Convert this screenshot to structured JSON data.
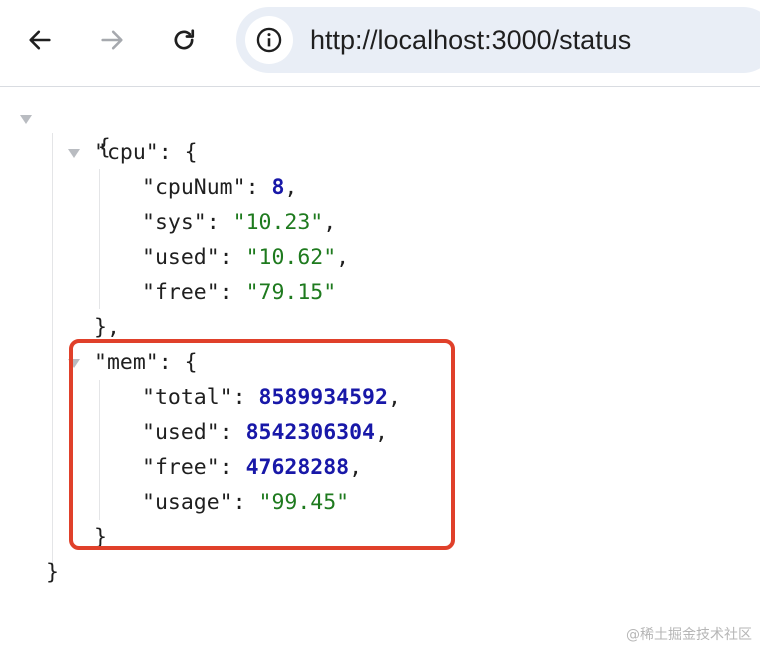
{
  "browser": {
    "url": "http://localhost:3000/status",
    "back_icon": "arrow-left-icon",
    "forward_icon": "arrow-right-icon",
    "reload_icon": "reload-icon",
    "site_info_icon": "info-icon"
  },
  "json": {
    "open_root": "{",
    "close_root": "}",
    "cpu": {
      "key": "\"cpu\"",
      "open": "{",
      "close": "},",
      "fields": [
        {
          "key": "\"cpuNum\"",
          "value": "8",
          "comma": ","
        },
        {
          "key": "\"sys\"",
          "value": "\"10.23\"",
          "comma": ","
        },
        {
          "key": "\"used\"",
          "value": "\"10.62\"",
          "comma": ","
        },
        {
          "key": "\"free\"",
          "value": "\"79.15\"",
          "comma": ""
        }
      ]
    },
    "mem": {
      "key": "\"mem\"",
      "open": "{",
      "close": "}",
      "fields": [
        {
          "key": "\"total\"",
          "value": "8589934592",
          "comma": ","
        },
        {
          "key": "\"used\"",
          "value": "8542306304",
          "comma": ","
        },
        {
          "key": "\"free\"",
          "value": "47628288",
          "comma": ","
        },
        {
          "key": "\"usage\"",
          "value": "\"99.45\"",
          "comma": ""
        }
      ]
    }
  },
  "colors": {
    "highlight": "#e0402a",
    "string_value": "#1e7a1e",
    "number_value": "#1818a8"
  },
  "watermark": "@稀土掘金技术社区"
}
